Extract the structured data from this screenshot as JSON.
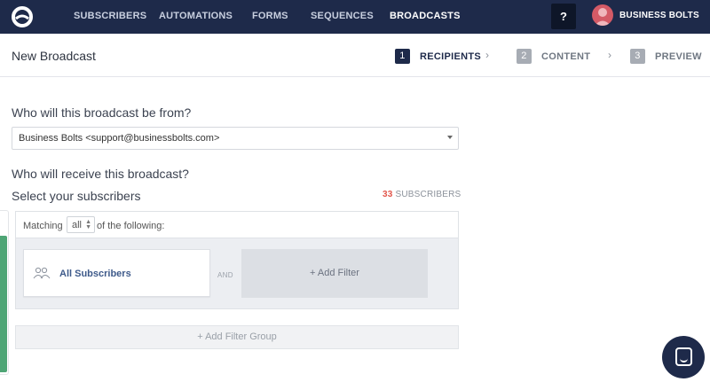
{
  "nav": {
    "items": [
      {
        "label": "SUBSCRIBERS",
        "active": false
      },
      {
        "label": "AUTOMATIONS",
        "active": false
      },
      {
        "label": "FORMS",
        "active": false
      },
      {
        "label": "SEQUENCES",
        "active": false
      },
      {
        "label": "BROADCASTS",
        "active": true
      }
    ],
    "help_label": "?",
    "account_name": "BUSINESS BOLTS"
  },
  "header": {
    "title": "New Broadcast",
    "steps": [
      {
        "num": "1",
        "label": "RECIPIENTS",
        "active": true
      },
      {
        "num": "2",
        "label": "CONTENT",
        "active": false
      },
      {
        "num": "3",
        "label": "PREVIEW",
        "active": false
      }
    ],
    "chevron": "›"
  },
  "form": {
    "from_question": "Who will this broadcast be from?",
    "from_value": "Business Bolts <support@businessbolts.com>",
    "receive_question": "Who will receive this broadcast?",
    "select_label": "Select your subscribers",
    "subscriber_count": "33",
    "subscriber_count_suffix": "SUBSCRIBERS",
    "matching_prefix": "Matching",
    "matching_value": "all",
    "matching_suffix": "of the following:",
    "filter_all": "All Subscribers",
    "and_label": "AND",
    "add_filter": "+ Add Filter",
    "add_filter_group": "+ Add Filter Group"
  },
  "colors": {
    "nav_bg": "#1e2a4a",
    "accent_count": "#e2574c",
    "filter_link": "#3e5a8a",
    "progress_green": "#4ea575"
  },
  "icons": [
    "logo-icon",
    "avatar",
    "chevron-right-icon",
    "caret-down-icon",
    "users-icon",
    "chat-icon"
  ]
}
